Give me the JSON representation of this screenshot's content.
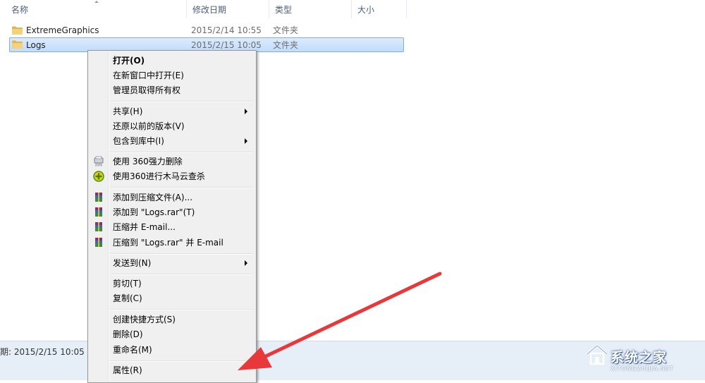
{
  "columns": [
    {
      "label": "名称"
    },
    {
      "label": "修改日期"
    },
    {
      "label": "类型"
    },
    {
      "label": "大小"
    }
  ],
  "files": [
    {
      "name": "ExtremeGraphics",
      "date": "2015/2/14 10:55",
      "type": "文件夹",
      "selected": false
    },
    {
      "name": "Logs",
      "date": "2015/2/15 10:05",
      "type": "文件夹",
      "selected": true
    }
  ],
  "status": {
    "text": "期: 2015/2/15 10:05"
  },
  "context_menu": {
    "items": [
      {
        "label": "打开(O)",
        "bold": true
      },
      {
        "label": "在新窗口中打开(E)"
      },
      {
        "label": "管理员取得所有权"
      },
      {
        "label": "共享(H)",
        "submenu": true
      },
      {
        "label": "还原以前的版本(V)"
      },
      {
        "label": "包含到库中(I)",
        "submenu": true
      },
      {
        "label": "使用 360强力删除",
        "icon": "shredder-icon"
      },
      {
        "label": "使用360进行木马云查杀",
        "icon": "360-scan-icon"
      },
      {
        "label": "添加到压缩文件(A)...",
        "icon": "winrar-icon"
      },
      {
        "label": "添加到 \"Logs.rar\"(T)",
        "icon": "winrar-icon"
      },
      {
        "label": "压缩并 E-mail...",
        "icon": "winrar-icon"
      },
      {
        "label": "压缩到 \"Logs.rar\" 并 E-mail",
        "icon": "winrar-icon"
      },
      {
        "label": "发送到(N)",
        "submenu": true
      },
      {
        "label": "剪切(T)"
      },
      {
        "label": "复制(C)"
      },
      {
        "label": "创建快捷方式(S)"
      },
      {
        "label": "删除(D)"
      },
      {
        "label": "重命名(M)"
      },
      {
        "label": "属性(R)"
      }
    ]
  },
  "watermark": {
    "text": "系统之家",
    "sub": "XITONGZHIJIA.NET"
  },
  "colors": {
    "annotation_arrow": "#e8383a",
    "selection": "#cce0fb",
    "statusbar": "#e6eef8"
  }
}
